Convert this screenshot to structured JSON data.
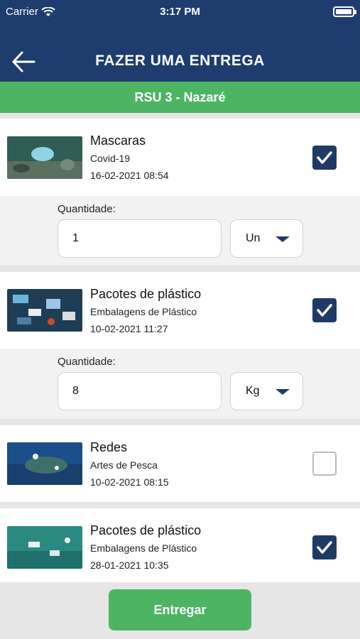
{
  "status": {
    "carrier": "Carrier",
    "time": "3:17 PM"
  },
  "header": {
    "title": "FAZER UMA ENTREGA",
    "subtitle": "RSU 3 - Nazaré"
  },
  "quantity_label": "Quantidade:",
  "items": [
    {
      "name": "Mascaras",
      "category": "Covid-19",
      "date": "16-02-2021 08:54",
      "checked": true,
      "quantity": "1",
      "unit": "Un"
    },
    {
      "name": "Pacotes de plástico",
      "category": "Embalagens de Plástico",
      "date": "10-02-2021 11:27",
      "checked": true,
      "quantity": "8",
      "unit": "Kg"
    },
    {
      "name": "Redes",
      "category": "Artes de Pesca",
      "date": "10-02-2021 08:15",
      "checked": false
    },
    {
      "name": "Pacotes de plástico",
      "category": "Embalagens de Plástico",
      "date": "28-01-2021 10:35",
      "checked": true
    }
  ],
  "footer": {
    "button_label": "Entregar"
  },
  "colors": {
    "header": "#1e3c6e",
    "accent_green": "#4db463",
    "checkbox": "#203a66"
  }
}
